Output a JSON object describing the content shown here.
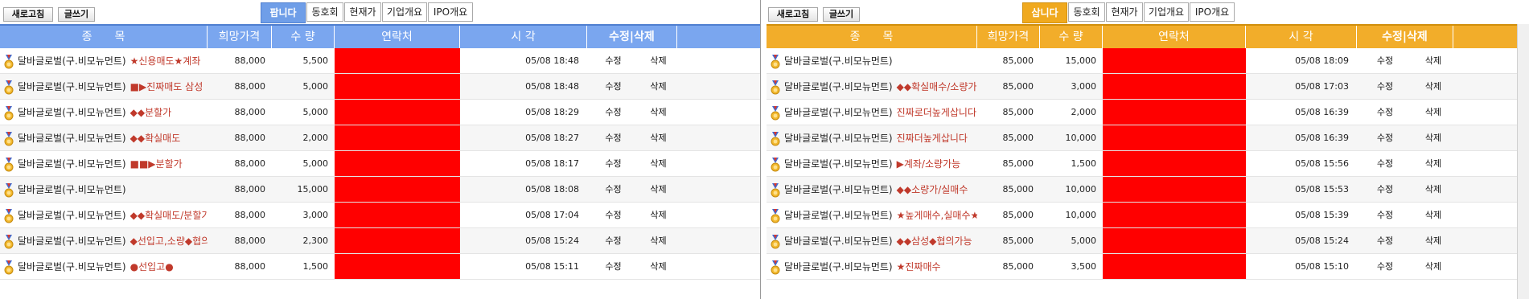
{
  "colors": {
    "sell_accent": "#6f9ee8",
    "buy_accent": "#f0a91e",
    "memo_text": "#c0392b",
    "contact_mask": "#ff0000"
  },
  "sell": {
    "refresh_label": "새로고침",
    "write_label": "글쓰기",
    "tabs": [
      {
        "label": "팝니다",
        "active": true
      },
      {
        "label": "동호회",
        "active": false
      },
      {
        "label": "현재가",
        "active": false
      },
      {
        "label": "기업개요",
        "active": false
      },
      {
        "label": "IPO개요",
        "active": false
      }
    ],
    "columns": {
      "item": "종　　목",
      "price": "희망가격",
      "qty": "수 량",
      "contact": "연락처",
      "time": "시 각",
      "edit_delete": "수정|삭제"
    },
    "rows": [
      {
        "company": "달바글로벌(구.비모뉴먼트)",
        "memo": "★신용매도★계좌",
        "price": "88,000",
        "qty": "5,500",
        "time": "05/08 18:48",
        "edit": "수정",
        "delete": "삭제"
      },
      {
        "company": "달바글로벌(구.비모뉴먼트)",
        "memo": "■▶진짜매도 삼성",
        "price": "88,000",
        "qty": "5,000",
        "time": "05/08 18:48",
        "edit": "수정",
        "delete": "삭제"
      },
      {
        "company": "달바글로벌(구.비모뉴먼트)",
        "memo": "◆◆분할가",
        "price": "88,000",
        "qty": "5,000",
        "time": "05/08 18:29",
        "edit": "수정",
        "delete": "삭제"
      },
      {
        "company": "달바글로벌(구.비모뉴먼트)",
        "memo": "◆◆확실매도",
        "price": "88,000",
        "qty": "2,000",
        "time": "05/08 18:27",
        "edit": "수정",
        "delete": "삭제"
      },
      {
        "company": "달바글로벌(구.비모뉴먼트)",
        "memo": "■■▶분할가",
        "price": "88,000",
        "qty": "5,000",
        "time": "05/08 18:17",
        "edit": "수정",
        "delete": "삭제"
      },
      {
        "company": "달바글로벌(구.비모뉴먼트)",
        "memo": "",
        "price": "88,000",
        "qty": "15,000",
        "time": "05/08 18:08",
        "edit": "수정",
        "delete": "삭제"
      },
      {
        "company": "달바글로벌(구.비모뉴먼트)",
        "memo": "◆◆확실매도/분할가",
        "price": "88,000",
        "qty": "3,000",
        "time": "05/08 17:04",
        "edit": "수정",
        "delete": "삭제"
      },
      {
        "company": "달바글로벌(구.비모뉴먼트)",
        "memo": "◆선입고,소량◆협의",
        "price": "88,000",
        "qty": "2,300",
        "time": "05/08 15:24",
        "edit": "수정",
        "delete": "삭제"
      },
      {
        "company": "달바글로벌(구.비모뉴먼트)",
        "memo": "●선입고●",
        "price": "88,000",
        "qty": "1,500",
        "time": "05/08 15:11",
        "edit": "수정",
        "delete": "삭제"
      }
    ]
  },
  "buy": {
    "refresh_label": "새로고침",
    "write_label": "글쓰기",
    "tabs": [
      {
        "label": "삽니다",
        "active": true
      },
      {
        "label": "동호회",
        "active": false
      },
      {
        "label": "현재가",
        "active": false
      },
      {
        "label": "기업개요",
        "active": false
      },
      {
        "label": "IPO개요",
        "active": false
      }
    ],
    "columns": {
      "item": "종　　목",
      "price": "희망가격",
      "qty": "수 량",
      "contact": "연락처",
      "time": "시 각",
      "edit_delete": "수정|삭제"
    },
    "rows": [
      {
        "company": "달바글로벌(구.비모뉴먼트)",
        "memo": "",
        "price": "85,000",
        "qty": "15,000",
        "time": "05/08 18:09",
        "edit": "수정",
        "delete": "삭제"
      },
      {
        "company": "달바글로벌(구.비모뉴먼트)",
        "memo": "◆◆확실매수/소량가",
        "price": "85,000",
        "qty": "3,000",
        "time": "05/08 17:03",
        "edit": "수정",
        "delete": "삭제"
      },
      {
        "company": "달바글로벌(구.비모뉴먼트)",
        "memo": "진짜로더높게삽니다",
        "price": "85,000",
        "qty": "2,000",
        "time": "05/08 16:39",
        "edit": "수정",
        "delete": "삭제"
      },
      {
        "company": "달바글로벌(구.비모뉴먼트)",
        "memo": "진짜더높게삽니다",
        "price": "85,000",
        "qty": "10,000",
        "time": "05/08 16:39",
        "edit": "수정",
        "delete": "삭제"
      },
      {
        "company": "달바글로벌(구.비모뉴먼트)",
        "memo": "▶계좌/소량가능",
        "price": "85,000",
        "qty": "1,500",
        "time": "05/08 15:56",
        "edit": "수정",
        "delete": "삭제"
      },
      {
        "company": "달바글로벌(구.비모뉴먼트)",
        "memo": "◆◆소량가/실매수",
        "price": "85,000",
        "qty": "10,000",
        "time": "05/08 15:53",
        "edit": "수정",
        "delete": "삭제"
      },
      {
        "company": "달바글로벌(구.비모뉴먼트)",
        "memo": "★높게매수,실매수★",
        "price": "85,000",
        "qty": "10,000",
        "time": "05/08 15:39",
        "edit": "수정",
        "delete": "삭제"
      },
      {
        "company": "달바글로벌(구.비모뉴먼트)",
        "memo": "◆◆삼성◆협의가능",
        "price": "85,000",
        "qty": "5,000",
        "time": "05/08 15:24",
        "edit": "수정",
        "delete": "삭제"
      },
      {
        "company": "달바글로벌(구.비모뉴먼트)",
        "memo": "★진짜매수",
        "price": "85,000",
        "qty": "3,500",
        "time": "05/08 15:10",
        "edit": "수정",
        "delete": "삭제"
      }
    ]
  }
}
